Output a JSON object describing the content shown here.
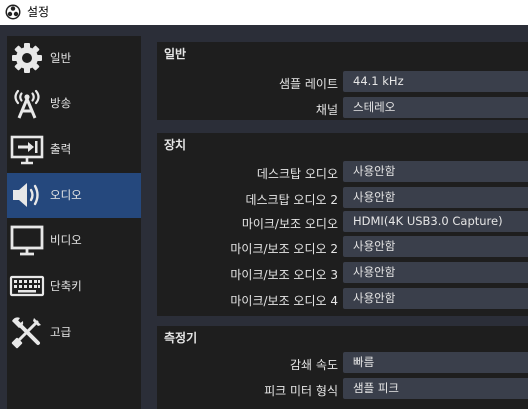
{
  "window": {
    "title": "설정"
  },
  "sidebar": {
    "items": [
      {
        "label": "일반",
        "icon": "gear-icon",
        "active": false
      },
      {
        "label": "방송",
        "icon": "broadcast-antenna-icon",
        "active": false
      },
      {
        "label": "출력",
        "icon": "output-monitor-icon",
        "active": false
      },
      {
        "label": "오디오",
        "icon": "speaker-icon",
        "active": true
      },
      {
        "label": "비디오",
        "icon": "monitor-icon",
        "active": false
      },
      {
        "label": "단축키",
        "icon": "keyboard-icon",
        "active": false
      },
      {
        "label": "고급",
        "icon": "tools-icon",
        "active": false
      }
    ]
  },
  "general": {
    "title": "일반",
    "sample_rate_label": "샘플 레이트",
    "sample_rate_value": "44.1 kHz",
    "channels_label": "채널",
    "channels_value": "스테레오"
  },
  "devices": {
    "title": "장치",
    "rows": [
      {
        "label": "데스크탑 오디오",
        "value": "사용안함"
      },
      {
        "label": "데스크탑 오디오 2",
        "value": "사용안함"
      },
      {
        "label": "마이크/보조 오디오",
        "value": "HDMI(4K USB3.0 Capture)"
      },
      {
        "label": "마이크/보조 오디오 2",
        "value": "사용안함"
      },
      {
        "label": "마이크/보조 오디오 3",
        "value": "사용안함"
      },
      {
        "label": "마이크/보조 오디오 4",
        "value": "사용안함"
      }
    ]
  },
  "meters": {
    "title": "측정기",
    "decay_label": "감쇄 속도",
    "decay_value": "빠름",
    "peak_label": "피크 미터 형식",
    "peak_value": "샘플 피크"
  },
  "colors": {
    "background": "#2b2e38",
    "panel": "#1e1e1e",
    "active": "#25487d",
    "field": "#3a3f4b"
  }
}
